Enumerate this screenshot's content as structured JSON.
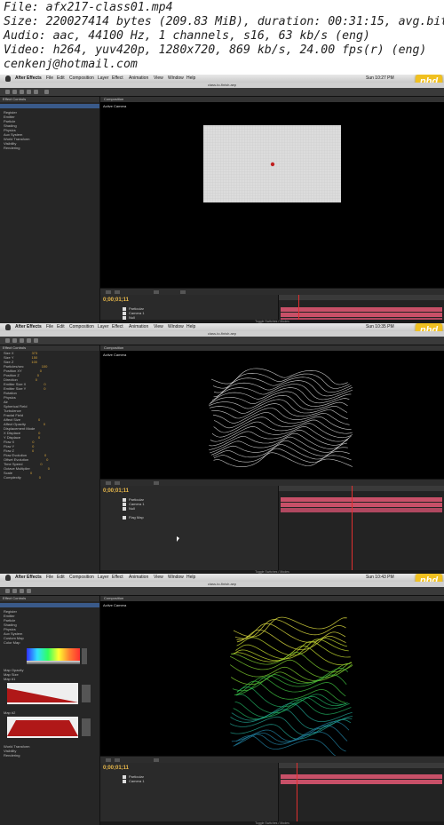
{
  "info": {
    "file": "File: afx217-class01.mp4",
    "size": "Size: 220027414 bytes (209.83 MiB), duration: 00:31:15, avg.bitrate: 9",
    "audio": "Audio: aac, 44100 Hz, 1 channels, s16, 63 kb/s (eng)",
    "video": "Video: h264, yuv420p, 1280x720, 869 kb/s, 24.00 fps(r) (eng)",
    "email": "cenkenj@hotmail.com"
  },
  "menu": [
    "After Effects",
    "File",
    "Edit",
    "Composition",
    "Layer",
    "Effect",
    "Animation",
    "View",
    "Window",
    "Help"
  ],
  "logo": "phd",
  "frames": [
    {
      "clock": "Sun 10:27 PM",
      "path": "class-to-finish.aep",
      "camera": "Active Camera",
      "timecode": "0;00;01;11",
      "layers": [
        "Particular",
        "Camera 1",
        "Null"
      ],
      "left_rows": [
        "Register",
        "Emitter",
        "Particle",
        "Shading",
        "Physics",
        "Aux System",
        "World Transform",
        "Visibility",
        "Rendering"
      ]
    },
    {
      "clock": "Sun 10:35 PM",
      "path": "class-to-finish.aep",
      "camera": "Active Camera",
      "timecode": "0;00;01;11",
      "layers": [
        "Particular",
        "Camera 1",
        "Null",
        "Flag Map"
      ],
      "left_rows": [
        "Size X",
        "Size Y",
        "Size Z",
        "Particles/sec",
        "Position XY",
        "Position Z",
        "Direction",
        "Emitter Size X",
        "Emitter Size Y",
        "Rotation",
        "Physics",
        "Air",
        "Spherical Field",
        "Turbulence",
        "Fractal Field",
        "Affect Size",
        "Affect Opacity",
        "Displacement Mode",
        "X Displace",
        "Y Displace",
        "Flow X",
        "Flow Y",
        "Flow Z",
        "Flow Evolution",
        "Offset Evolution",
        "Time Speed",
        "Octave Multiplier",
        "Scale",
        "Complexity"
      ]
    },
    {
      "clock": "Sun 10:43 PM",
      "path": "class-to-finish.aep",
      "camera": "Active Camera",
      "timecode": "0;00;01;11",
      "layers": [
        "Particular",
        "Camera 1"
      ],
      "left_rows": [
        "Register",
        "Emitter",
        "Particle",
        "Shading",
        "Physics",
        "Aux System",
        "Custom Map",
        "Color Map",
        "Map Opacity",
        "Map Size",
        "Map #1",
        "Map #2",
        "World Transform",
        "Visibility",
        "Rendering"
      ]
    }
  ]
}
